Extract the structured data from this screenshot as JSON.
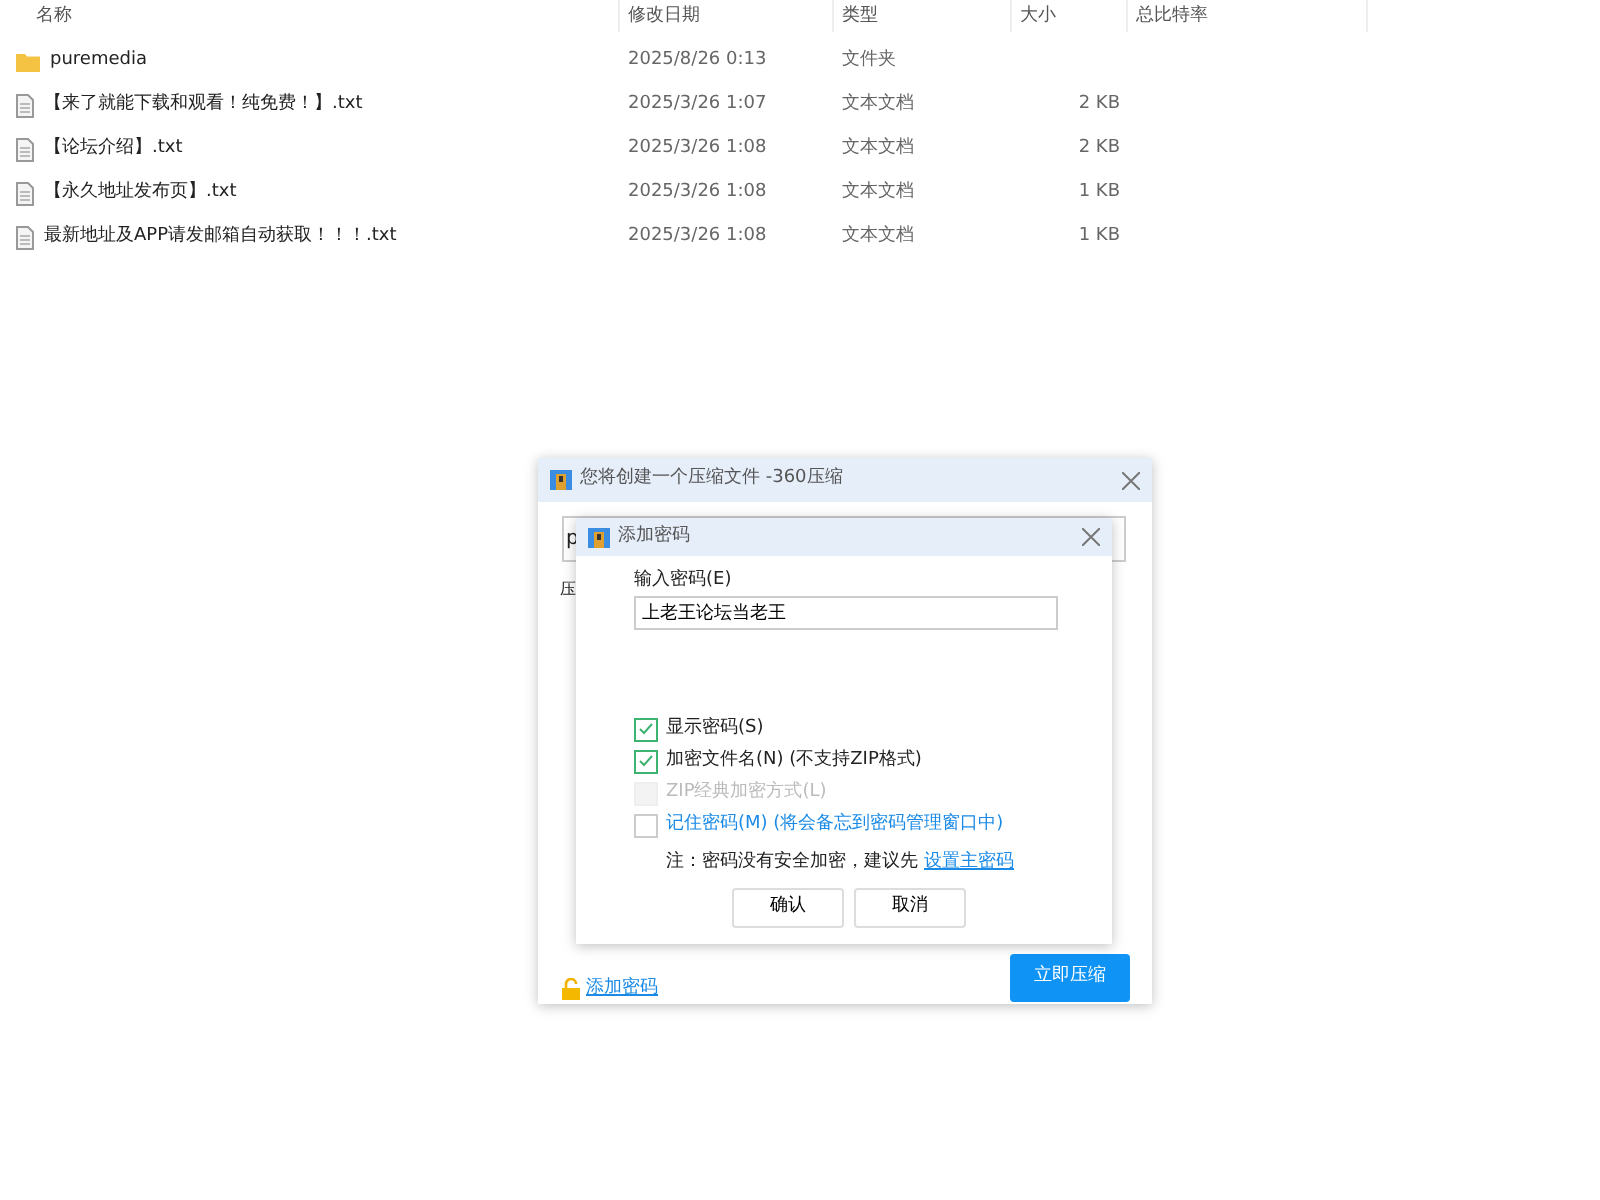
{
  "file_list": {
    "columns": [
      "名称",
      "修改日期",
      "类型",
      "大小",
      "总比特率"
    ],
    "rows": [
      {
        "kind": "folder",
        "name": "puremedia",
        "modified": "2025/8/26 0:13",
        "type": "文件夹"
      },
      {
        "kind": "file",
        "name": "【来了就能下载和观看！纯免费！】.txt",
        "modified": "2025/3/26 1:07",
        "type": "文本文档",
        "size": "2 KB"
      },
      {
        "kind": "file",
        "name": "【论坛介绍】.txt",
        "modified": "2025/3/26 1:08",
        "type": "文本文档",
        "size": "2 KB"
      },
      {
        "kind": "file",
        "name": "【永久地址发布页】.txt",
        "modified": "2025/3/26 1:08",
        "type": "文本文档",
        "size": "1 KB"
      },
      {
        "kind": "file",
        "name": "最新地址及APP请发邮箱自动获取！！！.txt",
        "modified": "2025/3/26 1:08",
        "type": "文本文档",
        "size": "1 KB"
      }
    ]
  },
  "compress_dialog": {
    "title": "您将创建一个压缩文件 -360压缩",
    "path_field": "p",
    "label": "压",
    "add_password_link": "添加密码",
    "compress_button": "立即压缩"
  },
  "password_dialog": {
    "title": "添加密码",
    "field_label": "输入密码(E)",
    "password": "上老王论坛当老王",
    "options": [
      {
        "kind": "plain",
        "label": "显示密码(S)",
        "checked": true,
        "disabled": false
      },
      {
        "kind": "plain",
        "label": "加密文件名(N) (不支持ZIP格式)",
        "checked": true,
        "disabled": false
      },
      {
        "kind": "plain",
        "label": "ZIP经典加密方式(L)",
        "checked": false,
        "disabled": true
      },
      {
        "kind": "link",
        "label": "记住密码(M) (将会备忘到密码管理窗口中)",
        "checked": false,
        "disabled": false
      }
    ],
    "note": "注：密码没有安全加密，建议先",
    "note_link": "设置主密码",
    "buttons": [
      "确认",
      "取消"
    ]
  }
}
